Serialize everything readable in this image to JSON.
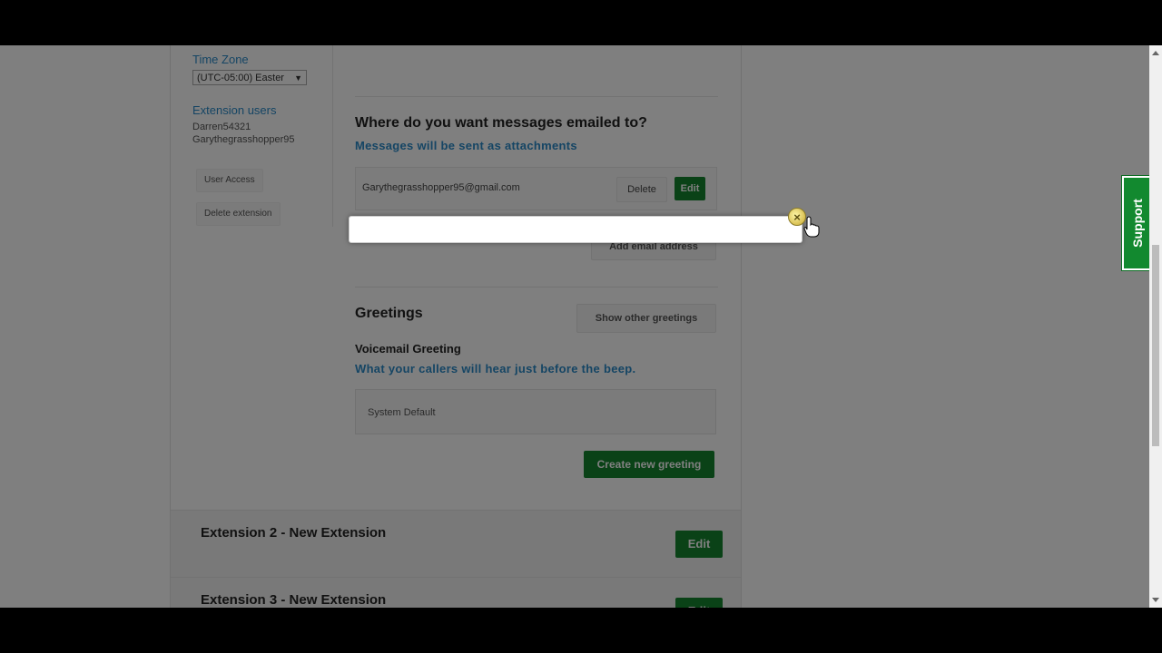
{
  "sidebar": {
    "time_zone_label": "Time Zone",
    "time_zone_value": "(UTC-05:00) Easter",
    "extension_users_label": "Extension users",
    "users": [
      "Darren54321",
      "Garythegrasshopper95"
    ],
    "user_access_label": "User Access",
    "delete_extension_label": "Delete extension"
  },
  "email_section": {
    "heading": "Where do you want messages emailed to?",
    "subheading": "Messages will be sent as attachments",
    "email": "Garythegrasshopper95@gmail.com",
    "delete_label": "Delete",
    "edit_label": "Edit",
    "add_email_label": "Add email address"
  },
  "greetings": {
    "heading": "Greetings",
    "show_other_label": "Show other greetings",
    "voicemail_title": "Voicemail Greeting",
    "voicemail_subtitle": "What your callers will hear just before the beep.",
    "current_greeting": "System Default",
    "create_label": "Create new greeting"
  },
  "extensions": [
    {
      "title": "Extension 2 - New Extension",
      "edit_label": "Edit"
    },
    {
      "title": "Extension 3 - New Extension",
      "edit_label": "Edit"
    }
  ],
  "modal": {
    "close_glyph": "×"
  },
  "support_tab": {
    "label": "Support"
  },
  "colors": {
    "accent_blue": "#2a8ac9",
    "action_green": "#15852e",
    "overlay": "rgba(0,0,0,0.5)"
  }
}
